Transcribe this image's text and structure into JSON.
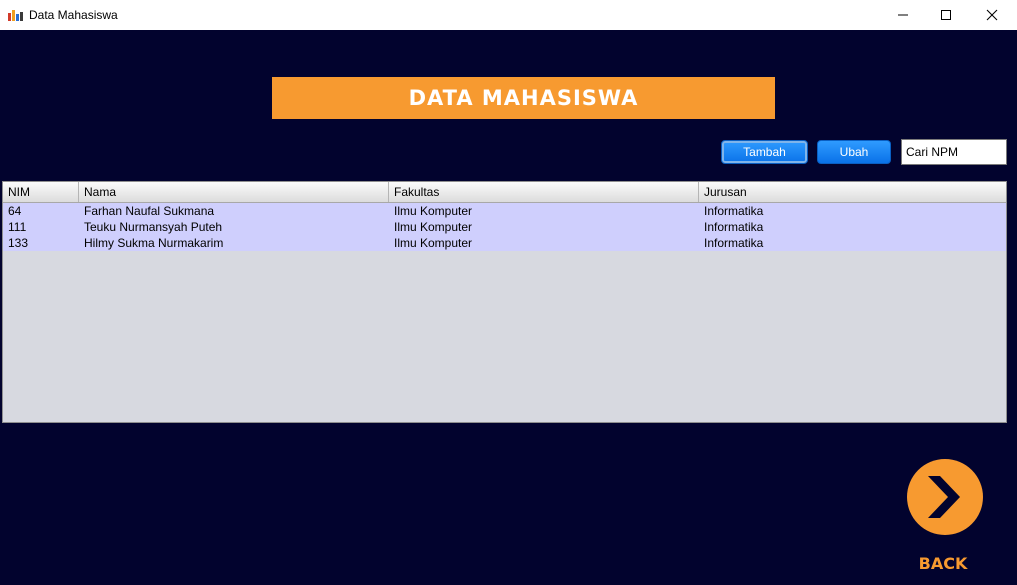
{
  "window": {
    "title": "Data Mahasiswa",
    "controls": [
      "minimize-icon",
      "maximize-icon",
      "close-icon"
    ]
  },
  "header": {
    "title": "DATA MAHASISWA"
  },
  "toolbar": {
    "add_label": "Tambah",
    "edit_label": "Ubah",
    "search_value": "Cari NPM"
  },
  "table": {
    "columns": [
      "NIM",
      "Nama",
      "Fakultas",
      "Jurusan"
    ],
    "rows": [
      [
        "64",
        "Farhan Naufal Sukmana",
        "Ilmu Komputer",
        "Informatika"
      ],
      [
        "111",
        "Teuku Nurmansyah Puteh",
        "Ilmu Komputer",
        "Informatika"
      ],
      [
        "133",
        "Hilmy Sukma Nurmakarim",
        "Ilmu Komputer",
        "Informatika"
      ]
    ]
  },
  "back": {
    "label": "BACK",
    "icon": "chevron-right-icon"
  },
  "colors": {
    "background": "#02032e",
    "accent": "#f79a30",
    "button": "#1a86f5",
    "row_highlight": "#cfcffd",
    "table_bg": "#d7d9e0"
  }
}
